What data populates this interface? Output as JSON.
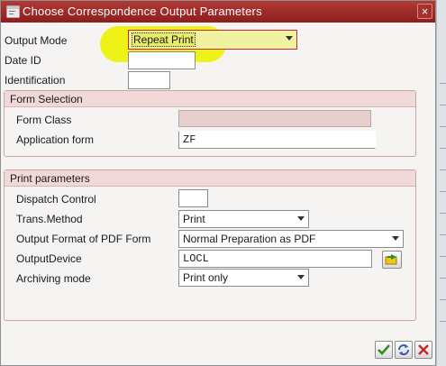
{
  "window": {
    "title": "Choose Correspondence Output Parameters",
    "close_label": "×"
  },
  "header_fields": {
    "output_mode": {
      "label": "Output Mode",
      "value": "Repeat Print"
    },
    "date_id": {
      "label": "Date ID",
      "value": ""
    },
    "identification": {
      "label": "Identification",
      "value": ""
    }
  },
  "form_selection": {
    "heading": "Form Selection",
    "form_class": {
      "label": "Form Class",
      "value": ""
    },
    "application_form": {
      "label": "Application form",
      "value": "ZF"
    }
  },
  "print_parameters": {
    "heading": "Print parameters",
    "dispatch_control": {
      "label": "Dispatch Control",
      "value": ""
    },
    "trans_method": {
      "label": "Trans.Method",
      "value": "Print"
    },
    "pdf_format": {
      "label": "Output Format of PDF Form",
      "value": "Normal Preparation as PDF"
    },
    "output_device": {
      "label": "OutputDevice",
      "value": "LOCL"
    },
    "archiving_mode": {
      "label": "Archiving mode",
      "value": "Print only"
    }
  },
  "colors": {
    "titlebar": "#9e2b28",
    "highlight": "#eef200",
    "group_header": "#f0d9d8"
  },
  "icons": [
    "window-icon",
    "close-icon",
    "dropdown-arrow-icon",
    "value-help-icon",
    "confirm-check-icon",
    "refresh-icon",
    "cancel-x-icon"
  ]
}
